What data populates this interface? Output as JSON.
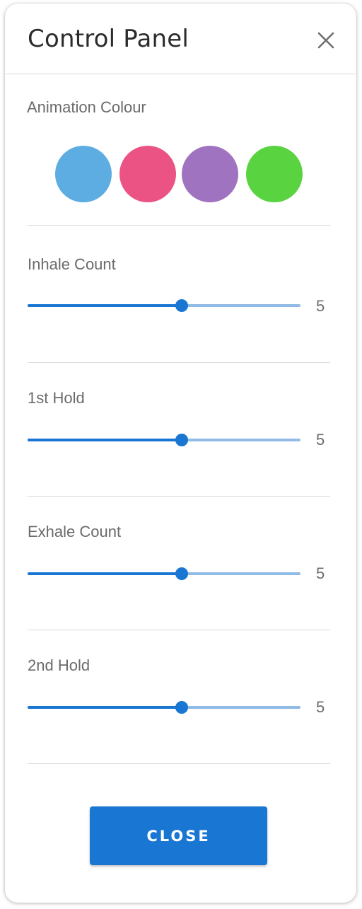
{
  "header": {
    "title": "Control Panel",
    "close_icon": "close-icon"
  },
  "animation_colour": {
    "label": "Animation Colour",
    "swatches": [
      {
        "name": "blue",
        "color": "#5dade3"
      },
      {
        "name": "pink",
        "color": "#ea5383"
      },
      {
        "name": "purple",
        "color": "#a073c1"
      },
      {
        "name": "green",
        "color": "#5ad341"
      }
    ]
  },
  "sliders": [
    {
      "label": "Inhale Count",
      "value": "5",
      "fraction": 0.565
    },
    {
      "label": "1st Hold",
      "value": "5",
      "fraction": 0.565
    },
    {
      "label": "Exhale Count",
      "value": "5",
      "fraction": 0.565
    },
    {
      "label": "2nd Hold",
      "value": "5",
      "fraction": 0.565
    }
  ],
  "footer": {
    "close_label": "CLOSE"
  },
  "colors": {
    "accent": "#1976d2",
    "rail": "#90bbe6"
  }
}
